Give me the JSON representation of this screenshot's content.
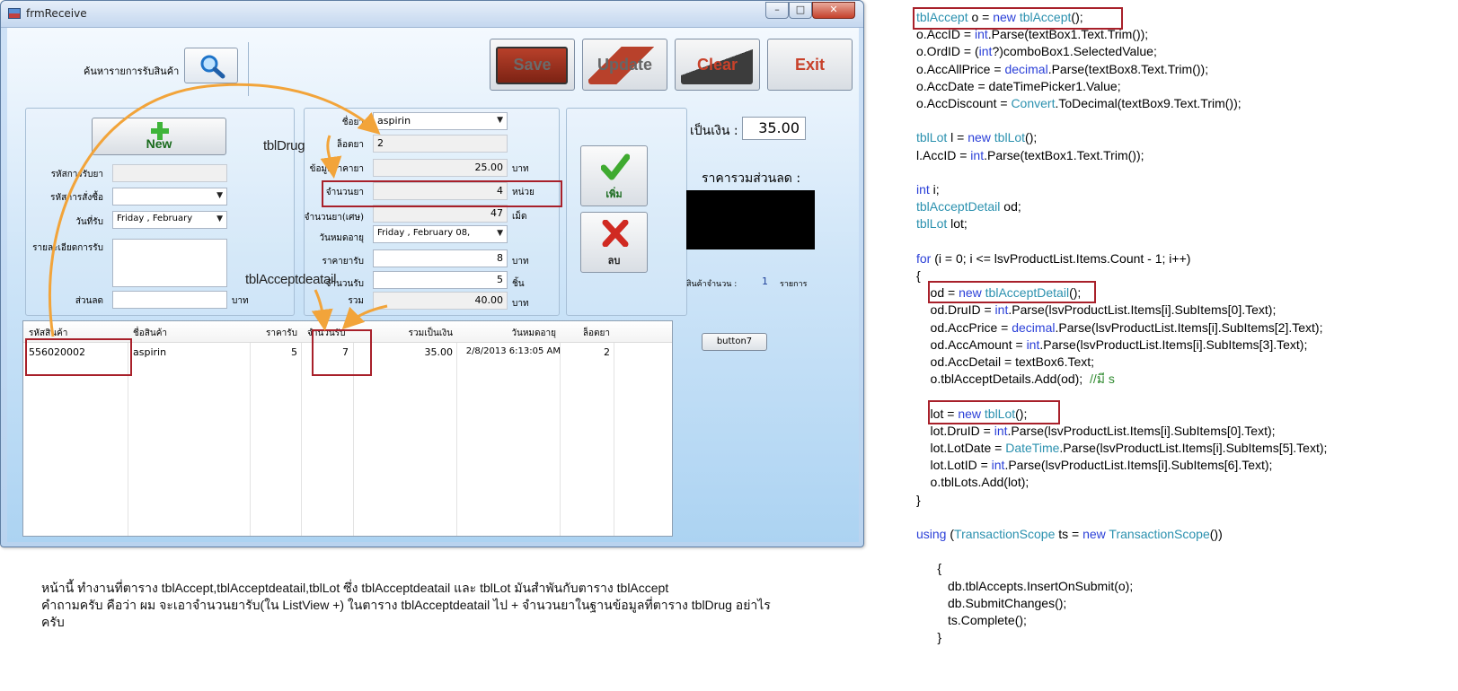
{
  "window": {
    "title": "frmReceive",
    "controls": {
      "minimize": "–",
      "maximize": "□",
      "close": "✕"
    }
  },
  "search": {
    "label": "ค้นหารายการรับสินค้า",
    "icon": "magnifier-icon"
  },
  "toolbar": {
    "save": "Save",
    "update": "Update",
    "clear": "Clear",
    "exit": "Exit"
  },
  "left_panel": {
    "new_button": "New",
    "fields": [
      {
        "label": "รหัสการรับยา",
        "value": ""
      },
      {
        "label": "รหัสการสั่งซื้อ",
        "value": ""
      },
      {
        "label": "วันที่รับ",
        "value": "Friday    ,  February"
      },
      {
        "label": "รายละเอียดการรับ",
        "value": ""
      },
      {
        "label": "ส่วนลด",
        "value": ""
      }
    ],
    "discount_unit": "บาท"
  },
  "drug_panel": {
    "fields": [
      {
        "label": "ชื่อยา",
        "value": "aspirin",
        "unit": ""
      },
      {
        "label": "ล็อตยา",
        "value": "2",
        "unit": ""
      },
      {
        "label": "ข้อมูลราคายา",
        "value": "25.00",
        "unit": "บาท"
      },
      {
        "label": "จำนวนยา",
        "value": "4",
        "unit": "หน่วย"
      },
      {
        "label": "จำนวนยา(เศษ)",
        "value": "47",
        "unit": "เม็ด"
      },
      {
        "label": "วันหมดอายุ",
        "value": "Friday    ,  February 08,",
        "unit": ""
      },
      {
        "label": "ราคายารับ",
        "value": "8",
        "unit": "บาท"
      },
      {
        "label": "จำนวนรับ",
        "value": "5",
        "unit": "ชิ้น"
      },
      {
        "label": "รวม",
        "value": "40.00",
        "unit": "บาท"
      }
    ]
  },
  "actions": {
    "add": "เพิ่ม",
    "delete": "ลบ"
  },
  "summary": {
    "total_label": "เป็นเงิน :",
    "total_value": "35.00",
    "discount_label": "ราคารวมส่วนลด :",
    "count_label": "สินค้าจำนวน :",
    "count_value": "1",
    "count_unit": "รายการ",
    "button7": "button7"
  },
  "listview": {
    "columns": [
      "รหัสสินค้า",
      "ชื่อสินค้า",
      "ราคารับ",
      "จำนวนรับ",
      "รวมเป็นเงิน",
      "วันหมดอายุ",
      "ล็อตยา"
    ],
    "rows": [
      [
        "556020002",
        "aspirin",
        "5",
        "7",
        "35.00",
        "2/8/2013 6:13:05 AM",
        "2"
      ]
    ]
  },
  "annotations": {
    "tbl_drug": "tblDrug",
    "tbl_accept_detail": "tblAcceptdeatail"
  },
  "caption": [
    "หน้านี้ ทำงานที่ตาราง tblAccept,tblAcceptdeatail,tblLot ซึ่ง tblAcceptdeatail และ tblLot มันสำพันกับตาราง tblAccept",
    "คำถามครับ คือว่า ผม จะเอาจำนวนยารับ(ใน ListView +) ในตาราง tblAcceptdeatail ไป + จำนวนยาในฐานข้อมูลที่ตาราง tblDrug อย่าไร",
    "ครับ"
  ],
  "code_lines": [
    "tblAccept o = new tblAccept();",
    "o.AccID = int.Parse(textBox1.Text.Trim());",
    "o.OrdID = (int?)comboBox1.SelectedValue;",
    "o.AccAllPrice = decimal.Parse(textBox8.Text.Trim());",
    "o.AccDate = dateTimePicker1.Value;",
    "o.AccDiscount = Convert.ToDecimal(textBox9.Text.Trim());",
    "",
    "tblLot l = new tblLot();",
    "l.AccID = int.Parse(textBox1.Text.Trim());",
    "",
    "int i;",
    "tblAcceptDetail od;",
    "tblLot lot;",
    "",
    "for (i = 0; i <= lsvProductList.Items.Count - 1; i++)",
    "{",
    "    od = new tblAcceptDetail();",
    "    od.DruID = int.Parse(lsvProductList.Items[i].SubItems[0].Text);",
    "    od.AccPrice = decimal.Parse(lsvProductList.Items[i].SubItems[2].Text);",
    "    od.AccAmount = int.Parse(lsvProductList.Items[i].SubItems[3].Text);",
    "    od.AccDetail = textBox6.Text;",
    "    o.tblAcceptDetails.Add(od);  //มี s",
    "",
    "    lot = new tblLot();",
    "    lot.DruID = int.Parse(lsvProductList.Items[i].SubItems[0].Text);",
    "    lot.LotDate = DateTime.Parse(lsvProductList.Items[i].SubItems[5].Text);",
    "    lot.LotID = int.Parse(lsvProductList.Items[i].SubItems[6].Text);",
    "    o.tblLots.Add(lot);",
    "}",
    "",
    "using (TransactionScope ts = new TransactionScope())",
    "",
    "      {",
    "         db.tblAccepts.InsertOnSubmit(o);",
    "         db.SubmitChanges();",
    "         ts.Complete();",
    "      }"
  ]
}
